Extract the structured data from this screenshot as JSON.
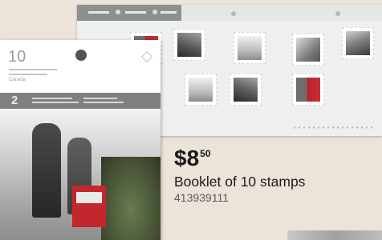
{
  "product": {
    "price_dollars": "$8",
    "price_cents": "50",
    "title": "Booklet of 10 stamps",
    "sku": "413939111"
  },
  "booklet": {
    "count": "10",
    "band_number": "2",
    "country": "Canada"
  },
  "colors": {
    "background": "#ece4d9",
    "text": "#1b1b1b",
    "sku": "#5a5a5a",
    "accent_red": "#c1272d",
    "band_grey": "#7e8180"
  },
  "icons": {
    "booklet_logo": "canada-post-logo-icon"
  }
}
